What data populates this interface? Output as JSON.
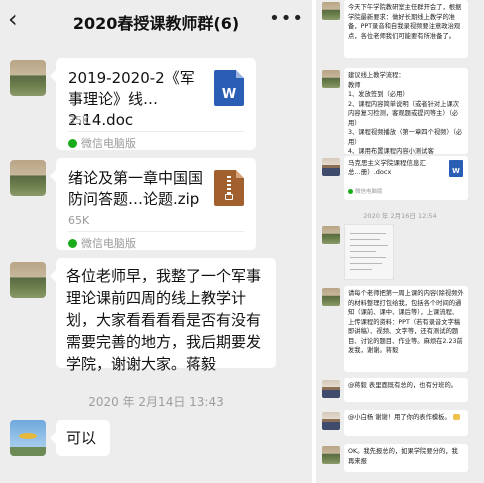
{
  "chat": {
    "back_icon": "back-arrow-icon",
    "title": "2020春授课教师群(6)",
    "more_icon": "more-dots-icon"
  },
  "messages": [
    {
      "type": "file",
      "file_name": "2019-2020-2《军事理论》线…2.14.doc",
      "file_size": "35K",
      "file_icon": "word-doc-icon",
      "file_icon_label": "W",
      "source": "微信电脑版"
    },
    {
      "type": "file",
      "file_name": "绪论及第一章中国国防问答题…论题.zip",
      "file_size": "65K",
      "file_icon": "zip-archive-icon",
      "source": "微信电脑版"
    },
    {
      "type": "text",
      "text": "各位老师早，我整了一个军事理论课前四周的线上教学计划，大家看看看看是否有没有需要完善的地方，我后期要发学院，谢谢大家。蒋毅"
    }
  ],
  "timestamp": "2020 年 2月14日  13:43",
  "reply_text": "可以",
  "right_panel": {
    "msg1": "今天下午学院教研室主任群开会了，根据学院最新要求：做好长期线上教学的准备，PPT录音和自我录视频要注意政治观点，各位老师我们可能要有所准备了。",
    "msg2": "建议线上教学流程：\n教师\n1、发放签到（必用）\n2、课程内容简单说明（或者针对上课次内容复习检测，客观题或提问等主）（必用）\n3、课程视频播放（第一章四个视频）（必用）\n4、课用布置课程内容小测试客",
    "file_name": "马克思主义学院课程信息汇总...册）.docx",
    "file_source": "微信电脑版",
    "file_icon_label": "W",
    "timestamp": "2020 年 2月16日 12:54",
    "msg3": "请每个老师把第一周上课的内容(除视频外的材料整理打包给我，包括各个时间的通知（课前、课中、课后等），上课流程、上传课程的资料：PPT（若有录音文字稿即讲稿）、视频、文字等，还有测试的题目、讨论的题目、作业等。麻烦在2.23前发我，谢谢。蒋毅",
    "msg4": "@蒋毅 表里面既有总的，也有分班的。",
    "msg5": "@小白杨 谢谢！用了你的表作模板。",
    "msg6": "OK。我先报总的，如果学院要分的，我再来报"
  },
  "colors": {
    "background": "#ededed",
    "bubble": "#ffffff",
    "word_icon": "#2a5eb5",
    "zip_icon": "#a3602f",
    "wechat_green": "#1aad19",
    "timestamp_text": "#9d9d9d"
  }
}
